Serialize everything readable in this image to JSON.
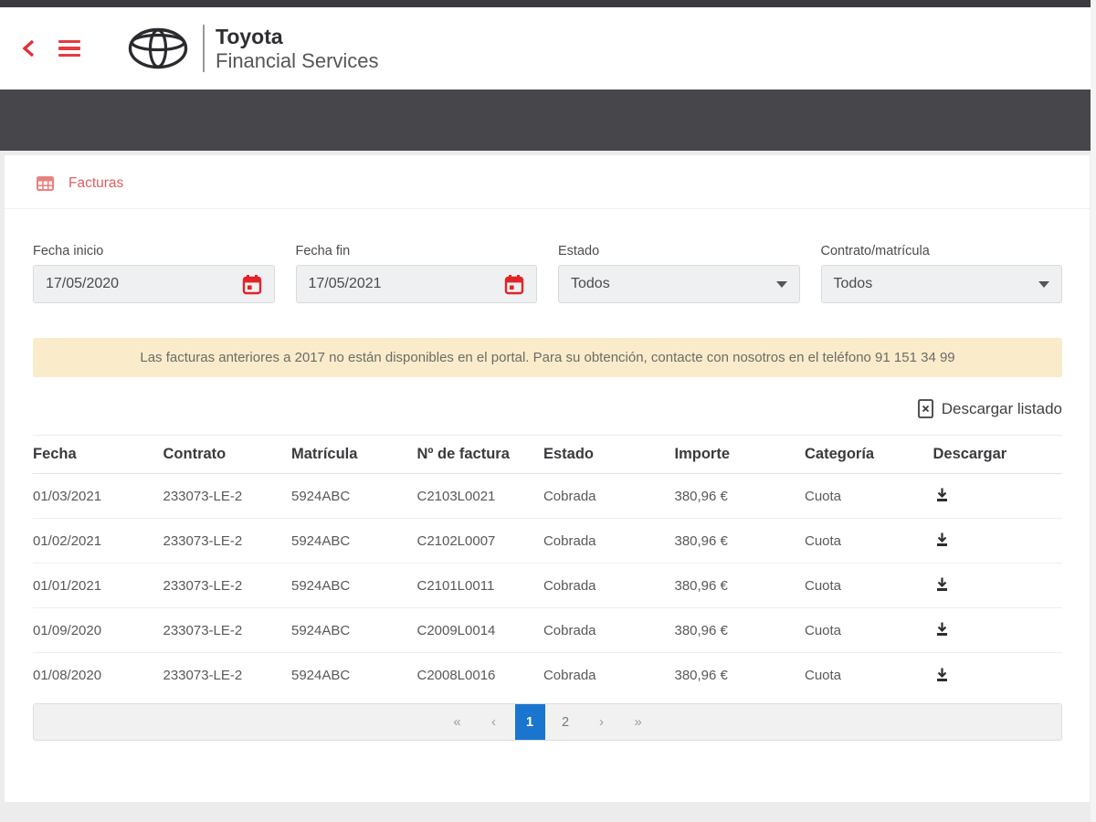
{
  "header": {
    "brand_line1": "Toyota",
    "brand_line2": "Financial Services"
  },
  "page": {
    "section_title": "Facturas"
  },
  "filters": {
    "fecha_inicio": {
      "label": "Fecha inicio",
      "value": "17/05/2020"
    },
    "fecha_fin": {
      "label": "Fecha fin",
      "value": "17/05/2021"
    },
    "estado": {
      "label": "Estado",
      "value": "Todos"
    },
    "contrato": {
      "label": "Contrato/matrícula",
      "value": "Todos"
    }
  },
  "notice": "Las facturas anteriores a 2017 no están disponibles en el portal. Para su obtención, contacte con nosotros en el teléfono 91 151 34 99",
  "download_list_label": "Descargar listado",
  "table": {
    "headers": [
      "Fecha",
      "Contrato",
      "Matrícula",
      "Nº de factura",
      "Estado",
      "Importe",
      "Categoría",
      "Descargar"
    ],
    "rows": [
      {
        "fecha": "01/03/2021",
        "contrato": "233073-LE-2",
        "matricula": "5924ABC",
        "factura": "C2103L0021",
        "estado": "Cobrada",
        "importe": "380,96 €",
        "categoria": "Cuota"
      },
      {
        "fecha": "01/02/2021",
        "contrato": "233073-LE-2",
        "matricula": "5924ABC",
        "factura": "C2102L0007",
        "estado": "Cobrada",
        "importe": "380,96 €",
        "categoria": "Cuota"
      },
      {
        "fecha": "01/01/2021",
        "contrato": "233073-LE-2",
        "matricula": "5924ABC",
        "factura": "C2101L0011",
        "estado": "Cobrada",
        "importe": "380,96 €",
        "categoria": "Cuota"
      },
      {
        "fecha": "01/09/2020",
        "contrato": "233073-LE-2",
        "matricula": "5924ABC",
        "factura": "C2009L0014",
        "estado": "Cobrada",
        "importe": "380,96 €",
        "categoria": "Cuota"
      },
      {
        "fecha": "01/08/2020",
        "contrato": "233073-LE-2",
        "matricula": "5924ABC",
        "factura": "C2008L0016",
        "estado": "Cobrada",
        "importe": "380,96 €",
        "categoria": "Cuota"
      }
    ]
  },
  "pagination": {
    "first_label": "«",
    "prev_label": "‹",
    "pages": [
      "1",
      "2"
    ],
    "active_page": "1",
    "next_label": "›",
    "last_label": "»"
  },
  "colors": {
    "accent_red": "#e8393f",
    "title_red": "#e05f5f",
    "dark_bar": "#47474b",
    "notice_bg": "#faeccb",
    "active_blue": "#1a75cf"
  }
}
